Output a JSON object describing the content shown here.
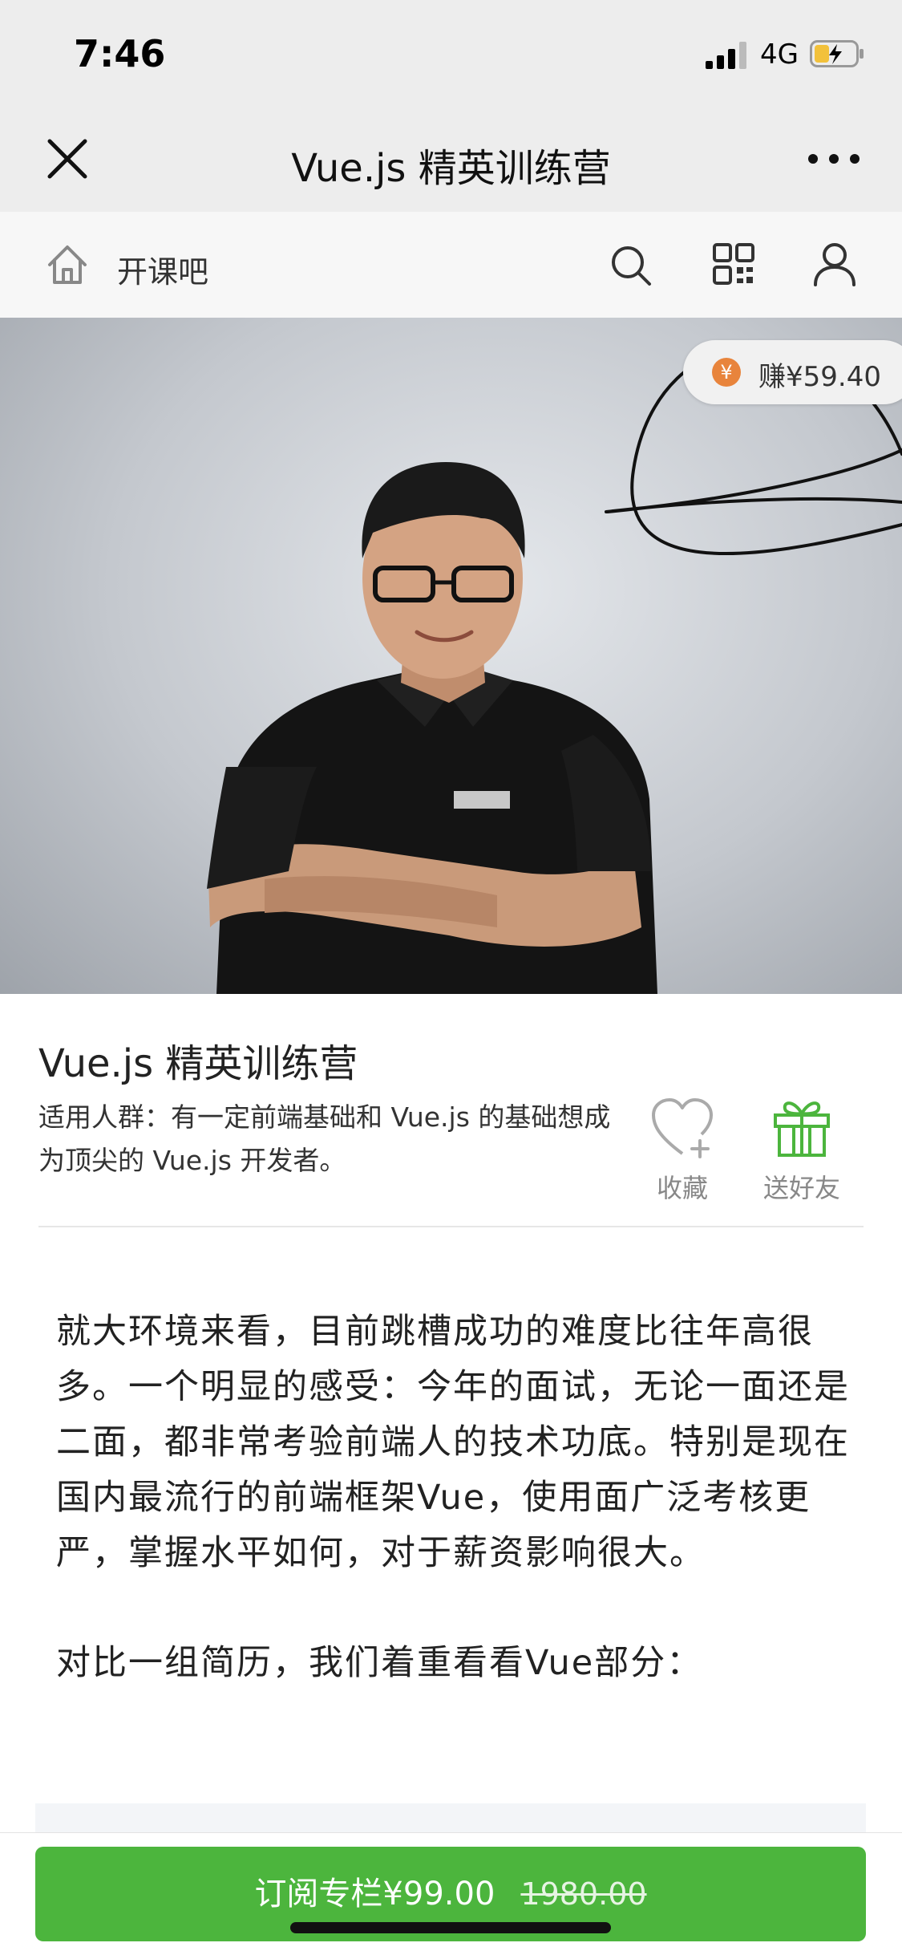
{
  "status_bar": {
    "time": "7:46",
    "network": "4G"
  },
  "nav": {
    "title": "Vue.js 精英训练营"
  },
  "site": {
    "name": "开课吧"
  },
  "hero": {
    "earn_label": "赚¥59.40",
    "earn_icon_glyph": "¥",
    "earn_icon_color": "#e8843c"
  },
  "course": {
    "title": "Vue.js 精英训练营",
    "audience": "适用人群：有一定前端基础和 Vue.js 的基础想成为顶尖的 Vue.js 开发者。",
    "favorite_label": "收藏",
    "gift_label": "送好友"
  },
  "article": {
    "paragraphs": [
      "就大环境来看，目前跳槽成功的难度比往年高很多。一个明显的感受：今年的面试，无论一面还是二面，都非常考验前端人的技术功底。特别是现在国内最流行的前端框架Vue，使用面广泛考核更严，掌握水平如何，对于薪资影响很大。",
      "对比一组简历，我们着重看看Vue部分："
    ]
  },
  "subscribe": {
    "label": "订阅专栏¥99.00",
    "original_price": "1980.00",
    "color": "#4cb53d"
  }
}
